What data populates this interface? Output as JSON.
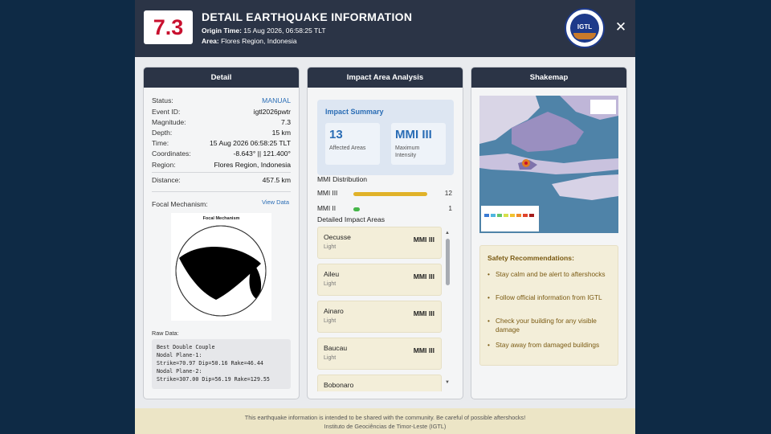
{
  "header": {
    "magnitude_badge": "7.3",
    "title": "DETAIL EARTHQUAKE INFORMATION",
    "origin_label": "Origin Time:",
    "origin_value": "15 Aug 2026, 06:58:25 TLT",
    "area_label": "Area:",
    "area_value": "Flores Region, Indonesia",
    "logo_text": "IGTL",
    "close_glyph": "✕"
  },
  "detail": {
    "title": "Detail",
    "rows": [
      {
        "label": "Status:",
        "value": "MANUAL"
      },
      {
        "label": "Event ID:",
        "value": "igtl2026pwtr"
      },
      {
        "label": "Magnitude:",
        "value": "7.3"
      },
      {
        "label": "Depth:",
        "value": "15 km"
      },
      {
        "label": "Time:",
        "value": "15 Aug 2026 06:58:25 TLT"
      },
      {
        "label": "Coordinates:",
        "value": "-8.643° || 121.400°"
      },
      {
        "label": "Region:",
        "value": "Flores Region, Indonesia"
      }
    ],
    "distance_label": "Distance:",
    "distance_value": "457.5 km",
    "focal_label": "Focal Mechanism:",
    "view_data": "View Data",
    "beachball_title": "Focal Mechanism",
    "raw_label": "Raw Data:",
    "raw_lines": [
      "Best Double Couple",
      "Nodal Plane-1:",
      "Strike=70.97 Dip=50.16 Rake=46.44",
      "Nodal Plane-2:",
      "Strike=307.00 Dip=56.19 Rake=129.55"
    ]
  },
  "impact": {
    "title": "Impact Area Analysis",
    "summary_title": "Impact Summary",
    "affected_value": "13",
    "affected_label": "Affected Areas",
    "max_value": "MMI III",
    "max_label_1": "Maximum",
    "max_label_2": "Intensity",
    "distribution_title": "MMI Distribution",
    "distribution": [
      {
        "name": "MMI III",
        "count": "12",
        "fraction": 0.92,
        "color": "#e0b229"
      },
      {
        "name": "MMI II",
        "count": "1",
        "fraction": 0.08,
        "color": "#45b649"
      }
    ],
    "detailed_title": "Detailed Impact Areas",
    "areas": [
      {
        "name": "Oecusse",
        "level": "Light",
        "mmi": "MMI III"
      },
      {
        "name": "Aileu",
        "level": "Light",
        "mmi": "MMI III"
      },
      {
        "name": "Ainaro",
        "level": "Light",
        "mmi": "MMI III"
      },
      {
        "name": "Baucau",
        "level": "Light",
        "mmi": "MMI III"
      },
      {
        "name": "Bobonaro",
        "level": "",
        "mmi": ""
      }
    ]
  },
  "shakemap": {
    "title": "Shakemap",
    "safety_title": "Safety Recommendations:",
    "safety_items": [
      "Stay calm and be alert to aftershocks",
      "Follow official information from IGTL",
      "Check your building for any visible damage",
      "Stay away from damaged buildings"
    ]
  },
  "footer": {
    "line1": "This earthquake information is intended to be shared with the community. Be careful of possible aftershocks!",
    "line2": "Instituto de Geociências de Timor-Leste (IGTL)"
  }
}
